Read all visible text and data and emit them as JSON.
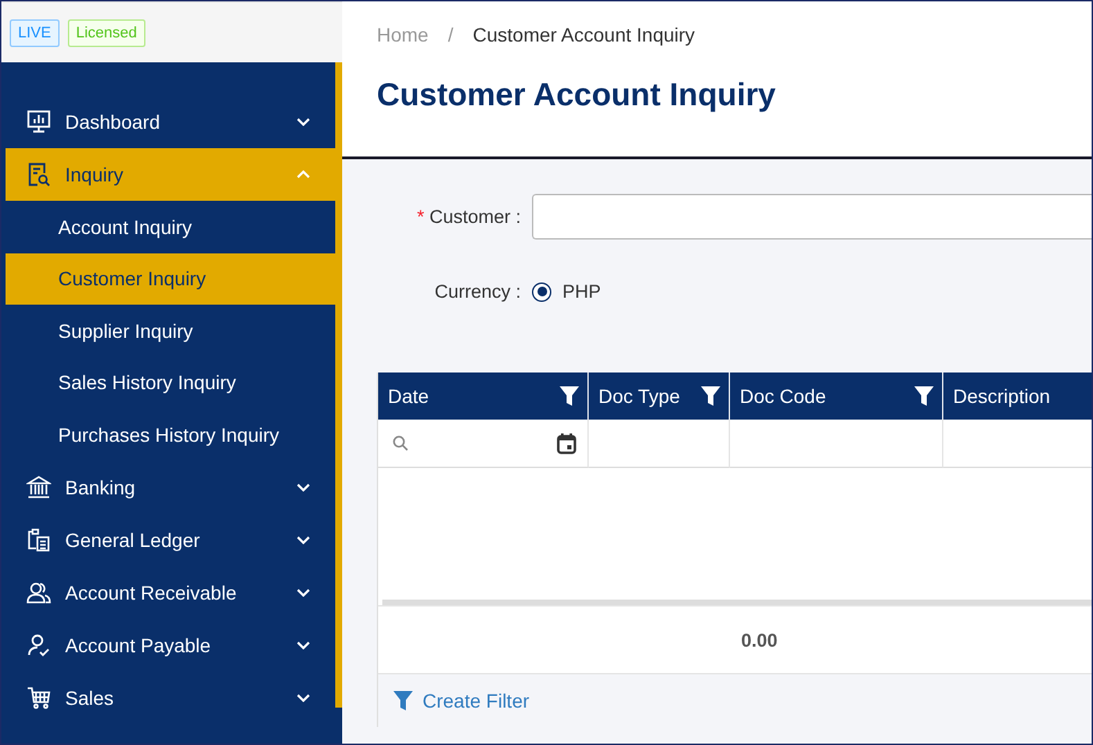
{
  "sidebar": {
    "badges": [
      {
        "label": "LIVE",
        "kind": "live"
      },
      {
        "label": "Licensed",
        "kind": "licensed"
      }
    ],
    "items": [
      {
        "label": "Dashboard",
        "kind": "monitor",
        "expanded": false,
        "selected": false
      },
      {
        "label": "Inquiry",
        "kind": "report",
        "expanded": true,
        "selected": true,
        "children": [
          {
            "label": "Account Inquiry",
            "selected": false
          },
          {
            "label": "Customer Inquiry",
            "selected": true
          },
          {
            "label": "Supplier Inquiry",
            "selected": false
          },
          {
            "label": "Sales History Inquiry",
            "selected": false
          },
          {
            "label": "Purchases History Inquiry",
            "selected": false
          }
        ]
      },
      {
        "label": "Banking",
        "kind": "bank",
        "expanded": false,
        "selected": false
      },
      {
        "label": "General Ledger",
        "kind": "ledger",
        "expanded": false,
        "selected": false
      },
      {
        "label": "Account Receivable",
        "kind": "people",
        "expanded": false,
        "selected": false
      },
      {
        "label": "Account Payable",
        "kind": "person",
        "expanded": false,
        "selected": false
      },
      {
        "label": "Sales",
        "kind": "cart",
        "expanded": false,
        "selected": false
      }
    ]
  },
  "breadcrumb": [
    {
      "label": "Home"
    },
    {
      "separator": "/",
      "label": "Customer Account Inquiry"
    }
  ],
  "page_title": "Customer Account Inquiry",
  "form": {
    "customer": {
      "label": "Customer :",
      "required_mark": "*"
    },
    "currency": {
      "label": "Currency :",
      "options": [
        {
          "label": "PHP",
          "selected": true
        }
      ]
    }
  },
  "table": {
    "columns": [
      {
        "label": "Date",
        "filter": true
      },
      {
        "label": "Doc Type",
        "filter": true
      },
      {
        "label": "Doc Code",
        "filter": true
      },
      {
        "label": "Description",
        "filter": false
      }
    ],
    "total": "0.00",
    "create_filter": "Create Filter"
  }
}
